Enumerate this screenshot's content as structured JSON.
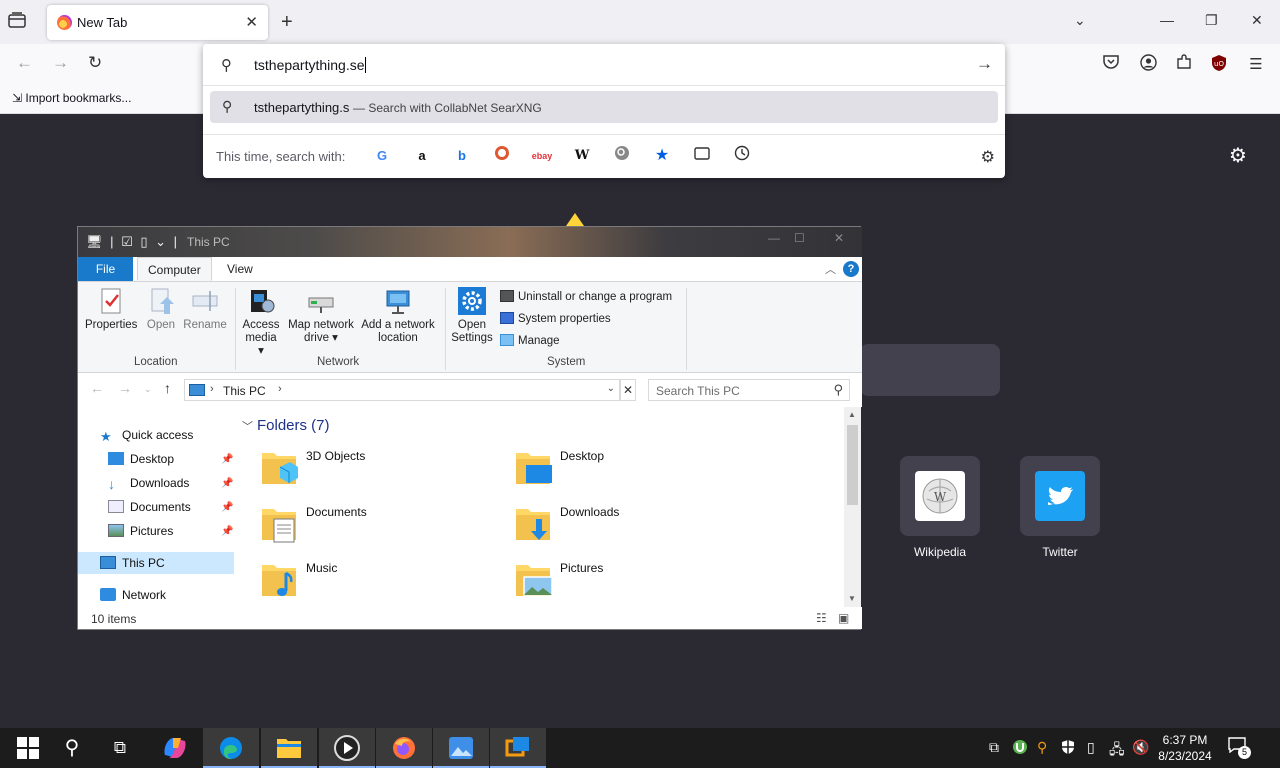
{
  "browser": {
    "tab": {
      "title": "New Tab"
    },
    "url_input": {
      "value": "tsthepartything.se"
    },
    "suggestion": {
      "text": "tsthepartything.s",
      "sub": "— Search with CollabNet SearXNG"
    },
    "one_off_label": "This time, search with:",
    "bookmarks": {
      "import_label": "Import bookmarks..."
    }
  },
  "newtab": {
    "shortcuts": [
      {
        "label": "Wikipedia"
      },
      {
        "label": "Twitter"
      }
    ]
  },
  "explorer": {
    "title": "This PC",
    "tabs": {
      "file": "File",
      "computer": "Computer",
      "view": "View"
    },
    "ribbon": {
      "properties": "Properties",
      "open": "Open",
      "rename": "Rename",
      "access_media_1": "Access",
      "access_media_2": "media ▾",
      "map_drive_1": "Map network",
      "map_drive_2": "drive ▾",
      "add_location_1": "Add a network",
      "add_location_2": "location",
      "open_settings_1": "Open",
      "open_settings_2": "Settings",
      "uninstall": "Uninstall or change a program",
      "system_properties": "System properties",
      "manage": "Manage",
      "group_location": "Location",
      "group_network": "Network",
      "group_system": "System"
    },
    "address": {
      "crumb": "This PC"
    },
    "search_placeholder": "Search This PC",
    "nav": {
      "quick_access": "Quick access",
      "desktop": "Desktop",
      "downloads": "Downloads",
      "documents": "Documents",
      "pictures": "Pictures",
      "this_pc": "This PC",
      "network": "Network"
    },
    "folders_header": "Folders (7)",
    "folders": [
      {
        "name": "3D Objects"
      },
      {
        "name": "Desktop"
      },
      {
        "name": "Documents"
      },
      {
        "name": "Downloads"
      },
      {
        "name": "Music"
      },
      {
        "name": "Pictures"
      }
    ],
    "status": "10 items"
  },
  "taskbar": {
    "clock_time": "6:37 PM",
    "clock_date": "8/23/2024",
    "notification_count": "5"
  },
  "colors": {
    "accent_blue": "#1979ca",
    "page_bg": "#2b2a33",
    "taskbar_bg": "#1c1c1c"
  }
}
